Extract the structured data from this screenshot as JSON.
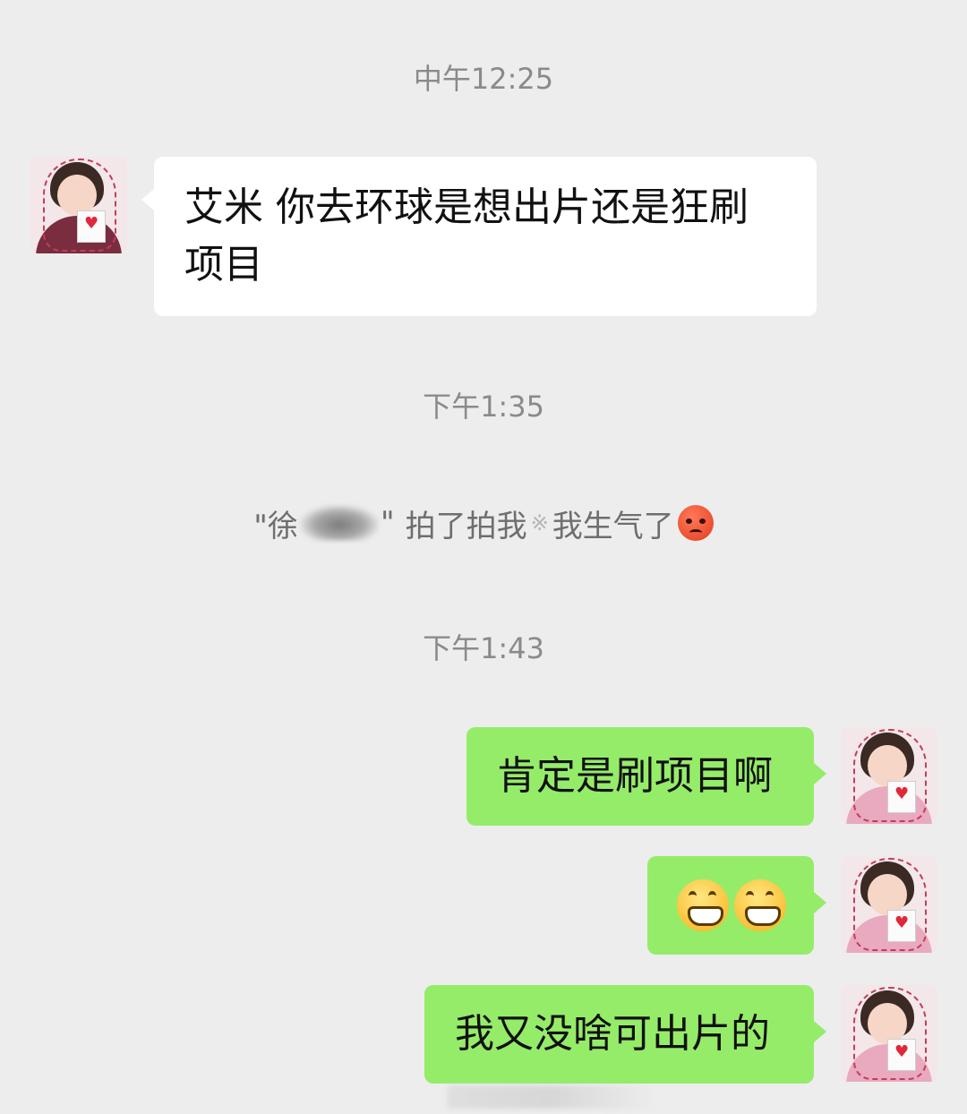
{
  "timestamps": {
    "t1": "中午12:25",
    "t2": "下午1:35",
    "t3": "下午1:43"
  },
  "system_notice": {
    "open_quote": "\"徐",
    "close_quote": "\"",
    "text1": "拍了拍我",
    "sparkle": "※",
    "text2": "我生气了",
    "emoji": "angry-face-icon"
  },
  "messages": [
    {
      "side": "left",
      "text": "艾米 你去环球是想出片还是狂刷项目"
    },
    {
      "side": "right",
      "text": "肯定是刷项目啊"
    },
    {
      "side": "right",
      "emoji": "grinning-face-icon",
      "emoji_count": 2
    },
    {
      "side": "right",
      "text": "我又没啥可出片的"
    }
  ],
  "colors": {
    "background": "#ededed",
    "incoming_bubble": "#ffffff",
    "outgoing_bubble": "#95ec69",
    "timestamp_text": "#8a8a8a"
  }
}
